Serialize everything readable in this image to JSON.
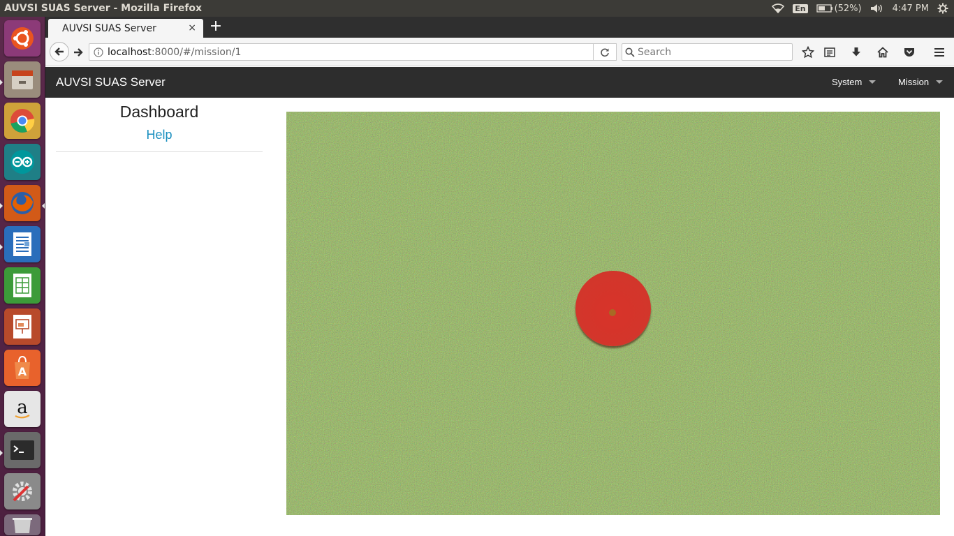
{
  "os": {
    "window_title": "AUVSI SUAS Server - Mozilla Firefox",
    "keyboard_layout": "En",
    "battery": "(52%)",
    "clock": "4:47 PM"
  },
  "launcher": {
    "apps": [
      {
        "name": "ubuntu-dash-icon",
        "color": "#e95420"
      },
      {
        "name": "files-icon",
        "color": "#9a8c7c"
      },
      {
        "name": "chrome-icon",
        "color": "#dd4b39"
      },
      {
        "name": "arduino-icon",
        "color": "#00979c"
      },
      {
        "name": "firefox-icon",
        "color": "#e66000"
      },
      {
        "name": "writer-icon",
        "color": "#2a6ebb"
      },
      {
        "name": "calc-icon",
        "color": "#3c9b39"
      },
      {
        "name": "impress-icon",
        "color": "#b84a2b"
      },
      {
        "name": "software-center-icon",
        "color": "#e8622c"
      },
      {
        "name": "amazon-icon",
        "color": "#e6e6e6"
      },
      {
        "name": "terminal-icon",
        "color": "#2b2b2b"
      },
      {
        "name": "system-settings-icon",
        "color": "#7a7a7a"
      },
      {
        "name": "trash-icon",
        "color": "#cfcfcf"
      }
    ]
  },
  "browser": {
    "tab_title": "AUVSI SUAS Server",
    "tab_close": "×",
    "new_tab": "+",
    "url_host": "localhost",
    "url_rest": ":8000/#/mission/1",
    "search_placeholder": "Search"
  },
  "app": {
    "brand": "AUVSI SUAS Server",
    "menus": {
      "system": "System",
      "mission": "Mission"
    },
    "sidebar": {
      "title": "Dashboard",
      "help_link": "Help"
    },
    "colors": {
      "navbar_bg": "#2d2d2d",
      "link": "#1a8fbf",
      "grass": "#4a6428",
      "target": "#d2362b"
    }
  }
}
